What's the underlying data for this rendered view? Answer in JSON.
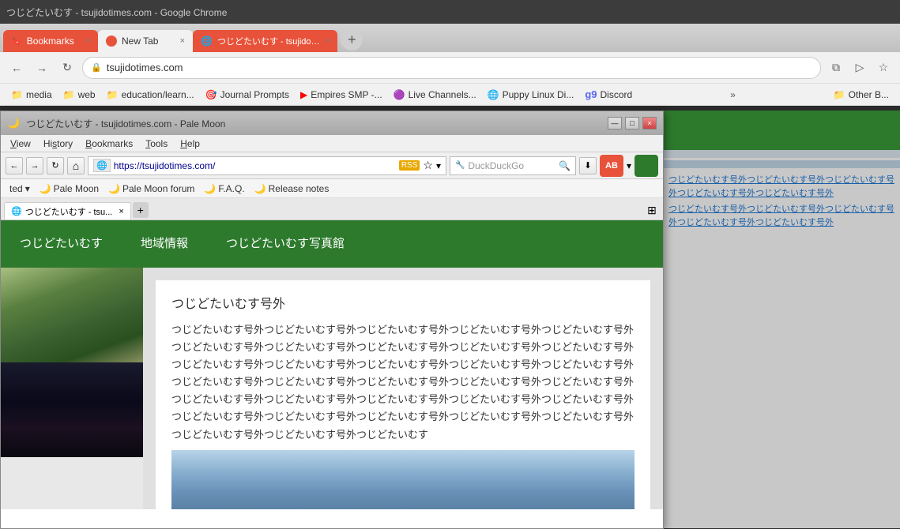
{
  "browser": {
    "titlebar": "つじどたいむす - tsujidotimes.com - Google Chrome",
    "tabs": [
      {
        "id": "bookmarks",
        "label": "Bookmarks",
        "active": false,
        "icon": "🔖"
      },
      {
        "id": "newtab",
        "label": "New Tab",
        "active": false,
        "icon": "✦"
      },
      {
        "id": "tsujido",
        "label": "つじどたいむす - tsujidoti...",
        "active": true,
        "icon": "🌐"
      }
    ],
    "new_tab_btn": "+",
    "address": "tsujidotimes.com",
    "address_full": "https://tsujidotimes.com/",
    "bookmarks": [
      {
        "id": "media",
        "label": "media",
        "type": "folder"
      },
      {
        "id": "web",
        "label": "web",
        "type": "folder"
      },
      {
        "id": "education",
        "label": "education/learn...",
        "type": "folder"
      },
      {
        "id": "journal",
        "label": "Journal Prompts",
        "type": "bookmark",
        "icon": "🎯"
      },
      {
        "id": "empires",
        "label": "Empires SMP -...",
        "type": "bookmark",
        "icon": "▶"
      },
      {
        "id": "live",
        "label": "Live Channels...",
        "type": "bookmark",
        "icon": "🟣"
      },
      {
        "id": "puppy",
        "label": "Puppy Linux Di...",
        "type": "bookmark",
        "icon": "🌐"
      },
      {
        "id": "discord",
        "label": "Discord",
        "type": "bookmark",
        "icon": "🎮"
      },
      {
        "id": "more",
        "label": "»",
        "type": "more"
      },
      {
        "id": "other",
        "label": "Other B...",
        "type": "folder"
      }
    ]
  },
  "palemoon": {
    "title": "つじどたいむす - tsujidotimes.com - Pale Moon",
    "menu": [
      "View",
      "History",
      "Bookmarks",
      "Tools",
      "Help"
    ],
    "address": "https://tsujidotimes.com/",
    "search_placeholder": "DuckDuckGo",
    "bookmarks": [
      {
        "id": "ted",
        "label": "ted",
        "has_arrow": true
      },
      {
        "id": "palemoon",
        "label": "Pale Moon",
        "icon": "🌙"
      },
      {
        "id": "forum",
        "label": "Pale Moon forum",
        "icon": "🌙"
      },
      {
        "id": "faq",
        "label": "F.A.Q.",
        "icon": "🌙"
      },
      {
        "id": "release",
        "label": "Release notes",
        "icon": "🌙"
      }
    ],
    "tab_label": "つじどたいむす - tsu...",
    "site_nav": [
      {
        "id": "nav1",
        "label": "つじどたいむす"
      },
      {
        "id": "nav2",
        "label": "地域情報"
      },
      {
        "id": "nav3",
        "label": "つじどたいむす写真館"
      }
    ],
    "article": {
      "title": "つじどたいむす号外",
      "body": "つじどたいむす号外つじどたいむす号外つじどたいむす号外つじどたいむす号外つじどたいむす号外つじどたいむす号外つじどたいむす号外つじどたいむす号外つじどたいむす号外つじどたいむす号外つじどたいむす号外つじどたいむす号外つじどたいむす号外つじどたいむす号外つじどたいむす号外つじどたいむす号外つじどたいむす号外つじどたいむす号外つじどたいむす号外つじどたいむす号外つじどたいむす号外つじどたいむす号外つじどたいむす号外つじどたいむす号外つじどたいむす号外つじどたいむす号外つじどたいむす号外つじどたいむす号外つじどたいむす号外つじどたいむす号外つじどたいむす号外つじどたいむす号外つじどたいむす"
    }
  },
  "right_panel": {
    "text_line1": "つじどたいむす号外つじどたいむす号外つじどたいむす号外つじどたいむす号外つじどたいむす号外",
    "text_line2": "つじどたいむす号外つじどたいむす号外つじどたいむす号外つじどたいむす号外つじどたいむす号外"
  },
  "icons": {
    "back": "←",
    "forward": "→",
    "reload": "↻",
    "lock": "🔒",
    "star": "☆",
    "menu": "≡",
    "close": "×",
    "minimize": "—",
    "maximize": "□",
    "rss": "RSS",
    "grid": "⊞",
    "down_arrow": "▾",
    "home": "⌂"
  }
}
